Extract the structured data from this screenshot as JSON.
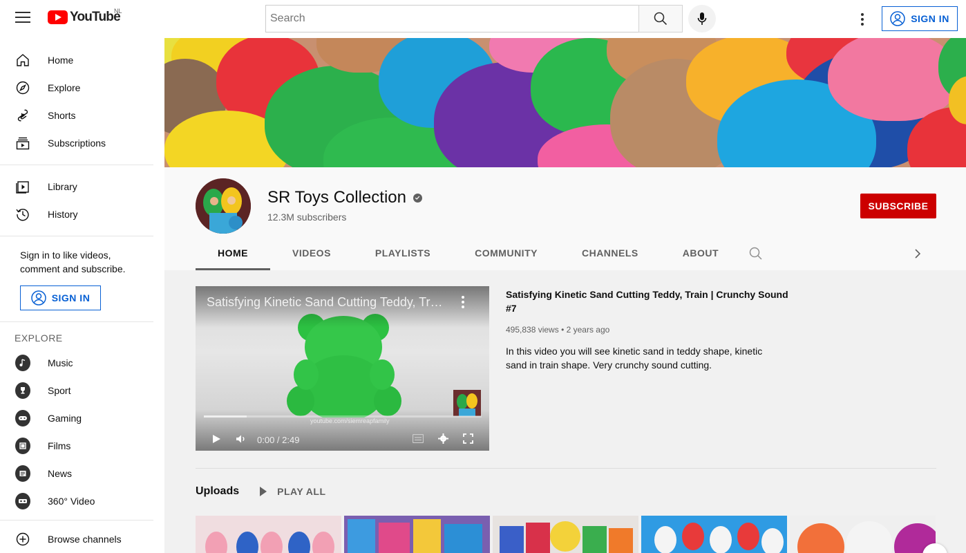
{
  "header": {
    "logo_text": "YouTube",
    "country_code": "NL",
    "search_placeholder": "Search",
    "sign_in_label": "SIGN IN"
  },
  "sidebar": {
    "primary": [
      {
        "label": "Home",
        "icon": "home-icon"
      },
      {
        "label": "Explore",
        "icon": "compass-icon"
      },
      {
        "label": "Shorts",
        "icon": "shorts-icon"
      },
      {
        "label": "Subscriptions",
        "icon": "subscriptions-icon"
      }
    ],
    "secondary": [
      {
        "label": "Library",
        "icon": "library-icon"
      },
      {
        "label": "History",
        "icon": "history-icon"
      }
    ],
    "sign_in_prompt": "Sign in to like videos, comment and subscribe.",
    "sign_in_label": "SIGN IN",
    "explore_heading": "EXPLORE",
    "explore": [
      {
        "label": "Music",
        "icon": "music-icon"
      },
      {
        "label": "Sport",
        "icon": "trophy-icon"
      },
      {
        "label": "Gaming",
        "icon": "gaming-icon"
      },
      {
        "label": "Films",
        "icon": "film-icon"
      },
      {
        "label": "News",
        "icon": "news-icon"
      },
      {
        "label": "360° Video",
        "icon": "vr-icon"
      }
    ],
    "browse_channels": "Browse channels"
  },
  "channel": {
    "name": "SR Toys Collection",
    "subscribers": "12.3M subscribers",
    "subscribe_label": "SUBSCRIBE",
    "tabs": [
      "HOME",
      "VIDEOS",
      "PLAYLISTS",
      "COMMUNITY",
      "CHANNELS",
      "ABOUT"
    ],
    "active_tab": "HOME"
  },
  "featured": {
    "player_title": "Satisfying Kinetic Sand Cutting Teddy, Train | Crunchy Sound #7",
    "time": "0:00 / 2:49",
    "watermark": "youtube.com/siemreapfamily",
    "title": "Satisfying Kinetic Sand Cutting Teddy, Train | Crunchy Sound #7",
    "views": "495,838 views",
    "age": "2 years ago",
    "description": "In this video you will see kinetic sand in teddy shape, kinetic sand in train shape. Very crunchy sound cutting."
  },
  "uploads": {
    "title": "Uploads",
    "play_all_label": "PLAY ALL"
  },
  "colors": {
    "brand_red": "#ff0000",
    "subscribe_red": "#cc0000",
    "link_blue": "#065fd4"
  }
}
